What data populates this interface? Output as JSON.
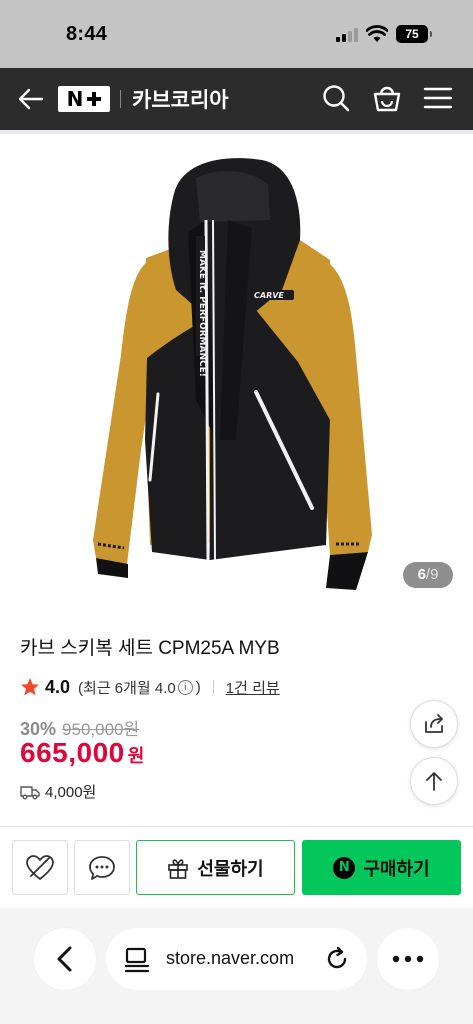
{
  "status_bar": {
    "time": "8:44",
    "battery": "75"
  },
  "header": {
    "logo_icon": "naver-plus-logo",
    "store_name": "카브코리아",
    "icons": [
      "back-arrow-icon",
      "search-icon",
      "shopping-bag-icon",
      "menu-icon"
    ]
  },
  "product": {
    "image_icon": "ski-jacket-image",
    "image_counter": {
      "current": "6",
      "separator": "/",
      "total": "9"
    },
    "title": "카브 스키복 세트 CPM25A MYB",
    "rating": {
      "score": "4.0",
      "recent_prefix": "(최근 6개월 4.0",
      "info_symbol": "i",
      "recent_suffix": ")",
      "review_count": "1건 리뷰"
    },
    "discount_rate": "30%",
    "original_price": "950,000원",
    "sale_price": "665,000",
    "sale_currency": "원",
    "shipping_fee": "4,000원"
  },
  "floating_buttons": {
    "share_icon": "share-icon",
    "top_icon": "arrow-up-icon"
  },
  "buy_bar": {
    "gift_label": "선물하기",
    "purchase_label": "구매하기",
    "naverpay_letter": "N"
  },
  "browser": {
    "url": "store.naver.com"
  },
  "colors": {
    "header_bg": "#2c2c2c",
    "sale_price": "#e0063a",
    "naver_green": "#03c75a",
    "star": "#f04a2c",
    "jacket_mustard": "#c9962f",
    "jacket_black": "#1c1c1f"
  }
}
